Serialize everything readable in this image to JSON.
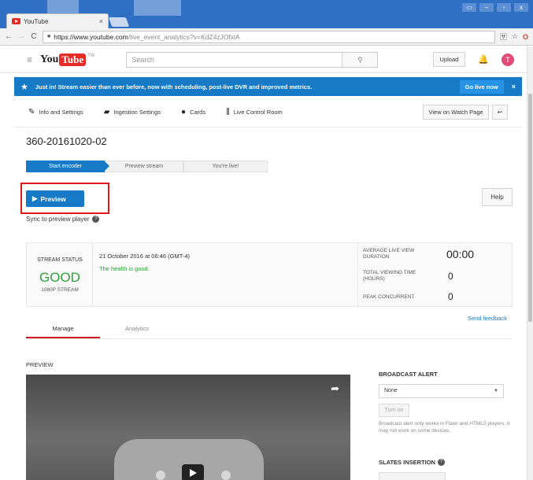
{
  "browser": {
    "tab_title": "YouTube",
    "tab_close": "×",
    "url_host": "https://www.youtube.com",
    "url_path": "/live_event_analytics?v=KdZ4zJOfxlA",
    "window_controls": [
      "▭",
      "–",
      "▫",
      "x"
    ]
  },
  "masthead": {
    "logo_you": "You",
    "logo_tube": "Tube",
    "logo_region": "TW",
    "search_placeholder": "Search",
    "upload_label": "Upload",
    "avatar_initial": "T"
  },
  "banner": {
    "text": "Just in! Stream easier than ever before, now with scheduling, post-live DVR and improved metrics.",
    "go_live_label": "Go live now",
    "close": "×"
  },
  "toolbar": {
    "items": [
      {
        "label": "Info and Settings",
        "icon": "pencil-icon"
      },
      {
        "label": "Ingestion Settings",
        "icon": "camera-icon"
      },
      {
        "label": "Cards",
        "icon": "info-icon"
      },
      {
        "label": "Live Control Room",
        "icon": "sliders-icon"
      }
    ],
    "watch_page_label": "View on Watch Page",
    "share_symbol": "↩"
  },
  "event": {
    "title": "360-20161020-02"
  },
  "steps": [
    "Start encoder",
    "Preview stream",
    "You're live!"
  ],
  "preview_button": {
    "label": "Preview"
  },
  "help_label": "Help",
  "sync_label": "Sync to preview player",
  "stream_status": {
    "label": "STREAM STATUS",
    "value": "GOOD",
    "resolution": "1080P STREAM",
    "date": "21 October 2016 at 06:46 (GMT-4)",
    "health": "The health is good."
  },
  "metrics": [
    {
      "label": "AVERAGE LIVE VIEW DURATION",
      "value": "00:00"
    },
    {
      "label": "TOTAL VIEWING TIME (HOURS)",
      "value": "0"
    },
    {
      "label": "PEAK CONCURRENT",
      "value": "0"
    }
  ],
  "feedback_label": "Send feedback",
  "subtabs": [
    "Manage",
    "Analytics"
  ],
  "preview_section_label": "PREVIEW",
  "broadcast_alert": {
    "title": "BROADCAST ALERT",
    "selected": "None",
    "turn_on_label": "Turn on",
    "note": "Broadcast alert only works in Flash and HTML5 players. It may not work on some devices."
  },
  "slates_title": "SLATES INSERTION",
  "colors": {
    "accent_blue": "#167ac6",
    "status_green": "#2d9d3a",
    "highlight_red": "#e0191f",
    "youtube_red": "#e52d27"
  }
}
